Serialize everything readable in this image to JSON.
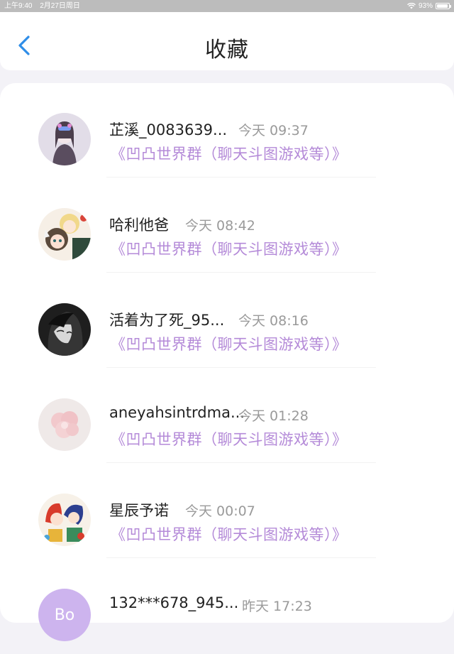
{
  "status": {
    "time": "上午9:40",
    "date": "2月27日周日",
    "battery": "93%",
    "battery_level": 0.93
  },
  "nav": {
    "title": "收藏",
    "back_icon": "chevron-left-icon"
  },
  "items": [
    {
      "name": "芷溪_0083639...",
      "time": "今天 09:37",
      "group": "《凹凸世界群（聊天斗图游戏等）》"
    },
    {
      "name": "哈利他爸",
      "time": "今天 08:42",
      "group": "《凹凸世界群（聊天斗图游戏等）》"
    },
    {
      "name": "活着为了死_95...",
      "time": "今天 08:16",
      "group": "《凹凸世界群（聊天斗图游戏等）》"
    },
    {
      "name": "aneyahsintrdma...",
      "time": "今天 01:28",
      "group": "《凹凸世界群（聊天斗图游戏等）》"
    },
    {
      "name": "星辰予诺",
      "time": "今天 00:07",
      "group": "《凹凸世界群（聊天斗图游戏等）》"
    },
    {
      "name": "132***678_945...",
      "time": "昨天 17:23",
      "group": ""
    }
  ],
  "colors": {
    "accent": "#2f8ee8",
    "group_text": "#b48ad8",
    "time_text": "#9a9a9a"
  }
}
